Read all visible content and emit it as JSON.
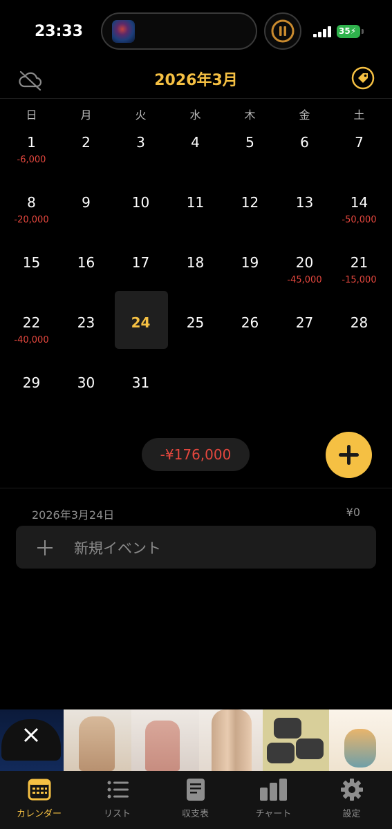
{
  "status_bar": {
    "time": "23:33",
    "battery": "35"
  },
  "header": {
    "title": "2026年3月",
    "left_icon": "cloud-off-icon",
    "right_icon": "tag-icon",
    "accent_color": "#f5c043"
  },
  "calendar": {
    "weekdays": [
      "日",
      "月",
      "火",
      "水",
      "木",
      "金",
      "土"
    ],
    "weeks": [
      [
        {
          "day": "1",
          "amount": "-6,000"
        },
        {
          "day": "2",
          "amount": ""
        },
        {
          "day": "3",
          "amount": ""
        },
        {
          "day": "4",
          "amount": ""
        },
        {
          "day": "5",
          "amount": ""
        },
        {
          "day": "6",
          "amount": ""
        },
        {
          "day": "7",
          "amount": ""
        }
      ],
      [
        {
          "day": "8",
          "amount": "-20,000"
        },
        {
          "day": "9",
          "amount": ""
        },
        {
          "day": "10",
          "amount": ""
        },
        {
          "day": "11",
          "amount": ""
        },
        {
          "day": "12",
          "amount": ""
        },
        {
          "day": "13",
          "amount": ""
        },
        {
          "day": "14",
          "amount": "-50,000"
        }
      ],
      [
        {
          "day": "15",
          "amount": ""
        },
        {
          "day": "16",
          "amount": ""
        },
        {
          "day": "17",
          "amount": ""
        },
        {
          "day": "18",
          "amount": ""
        },
        {
          "day": "19",
          "amount": ""
        },
        {
          "day": "20",
          "amount": "-45,000"
        },
        {
          "day": "21",
          "amount": "-15,000"
        }
      ],
      [
        {
          "day": "22",
          "amount": "-40,000"
        },
        {
          "day": "23",
          "amount": ""
        },
        {
          "day": "24",
          "amount": "",
          "today": true
        },
        {
          "day": "25",
          "amount": ""
        },
        {
          "day": "26",
          "amount": ""
        },
        {
          "day": "27",
          "amount": ""
        },
        {
          "day": "28",
          "amount": ""
        }
      ],
      [
        {
          "day": "29",
          "amount": ""
        },
        {
          "day": "30",
          "amount": ""
        },
        {
          "day": "31",
          "amount": ""
        }
      ]
    ],
    "negative_color": "#e5473e"
  },
  "summary": {
    "total": "-¥176,000",
    "add_button_icon": "plus-icon"
  },
  "selected_day": {
    "date": "2026年3月24日",
    "total": "¥0",
    "new_event_label": "新規イベント"
  },
  "tabs": [
    {
      "label": "カレンダー",
      "icon": "calendar-icon",
      "active": true
    },
    {
      "label": "リスト",
      "icon": "list-icon",
      "active": false
    },
    {
      "label": "収支表",
      "icon": "document-icon",
      "active": false
    },
    {
      "label": "チャート",
      "icon": "bar-chart-icon",
      "active": false
    },
    {
      "label": "設定",
      "icon": "gear-icon",
      "active": false
    }
  ]
}
